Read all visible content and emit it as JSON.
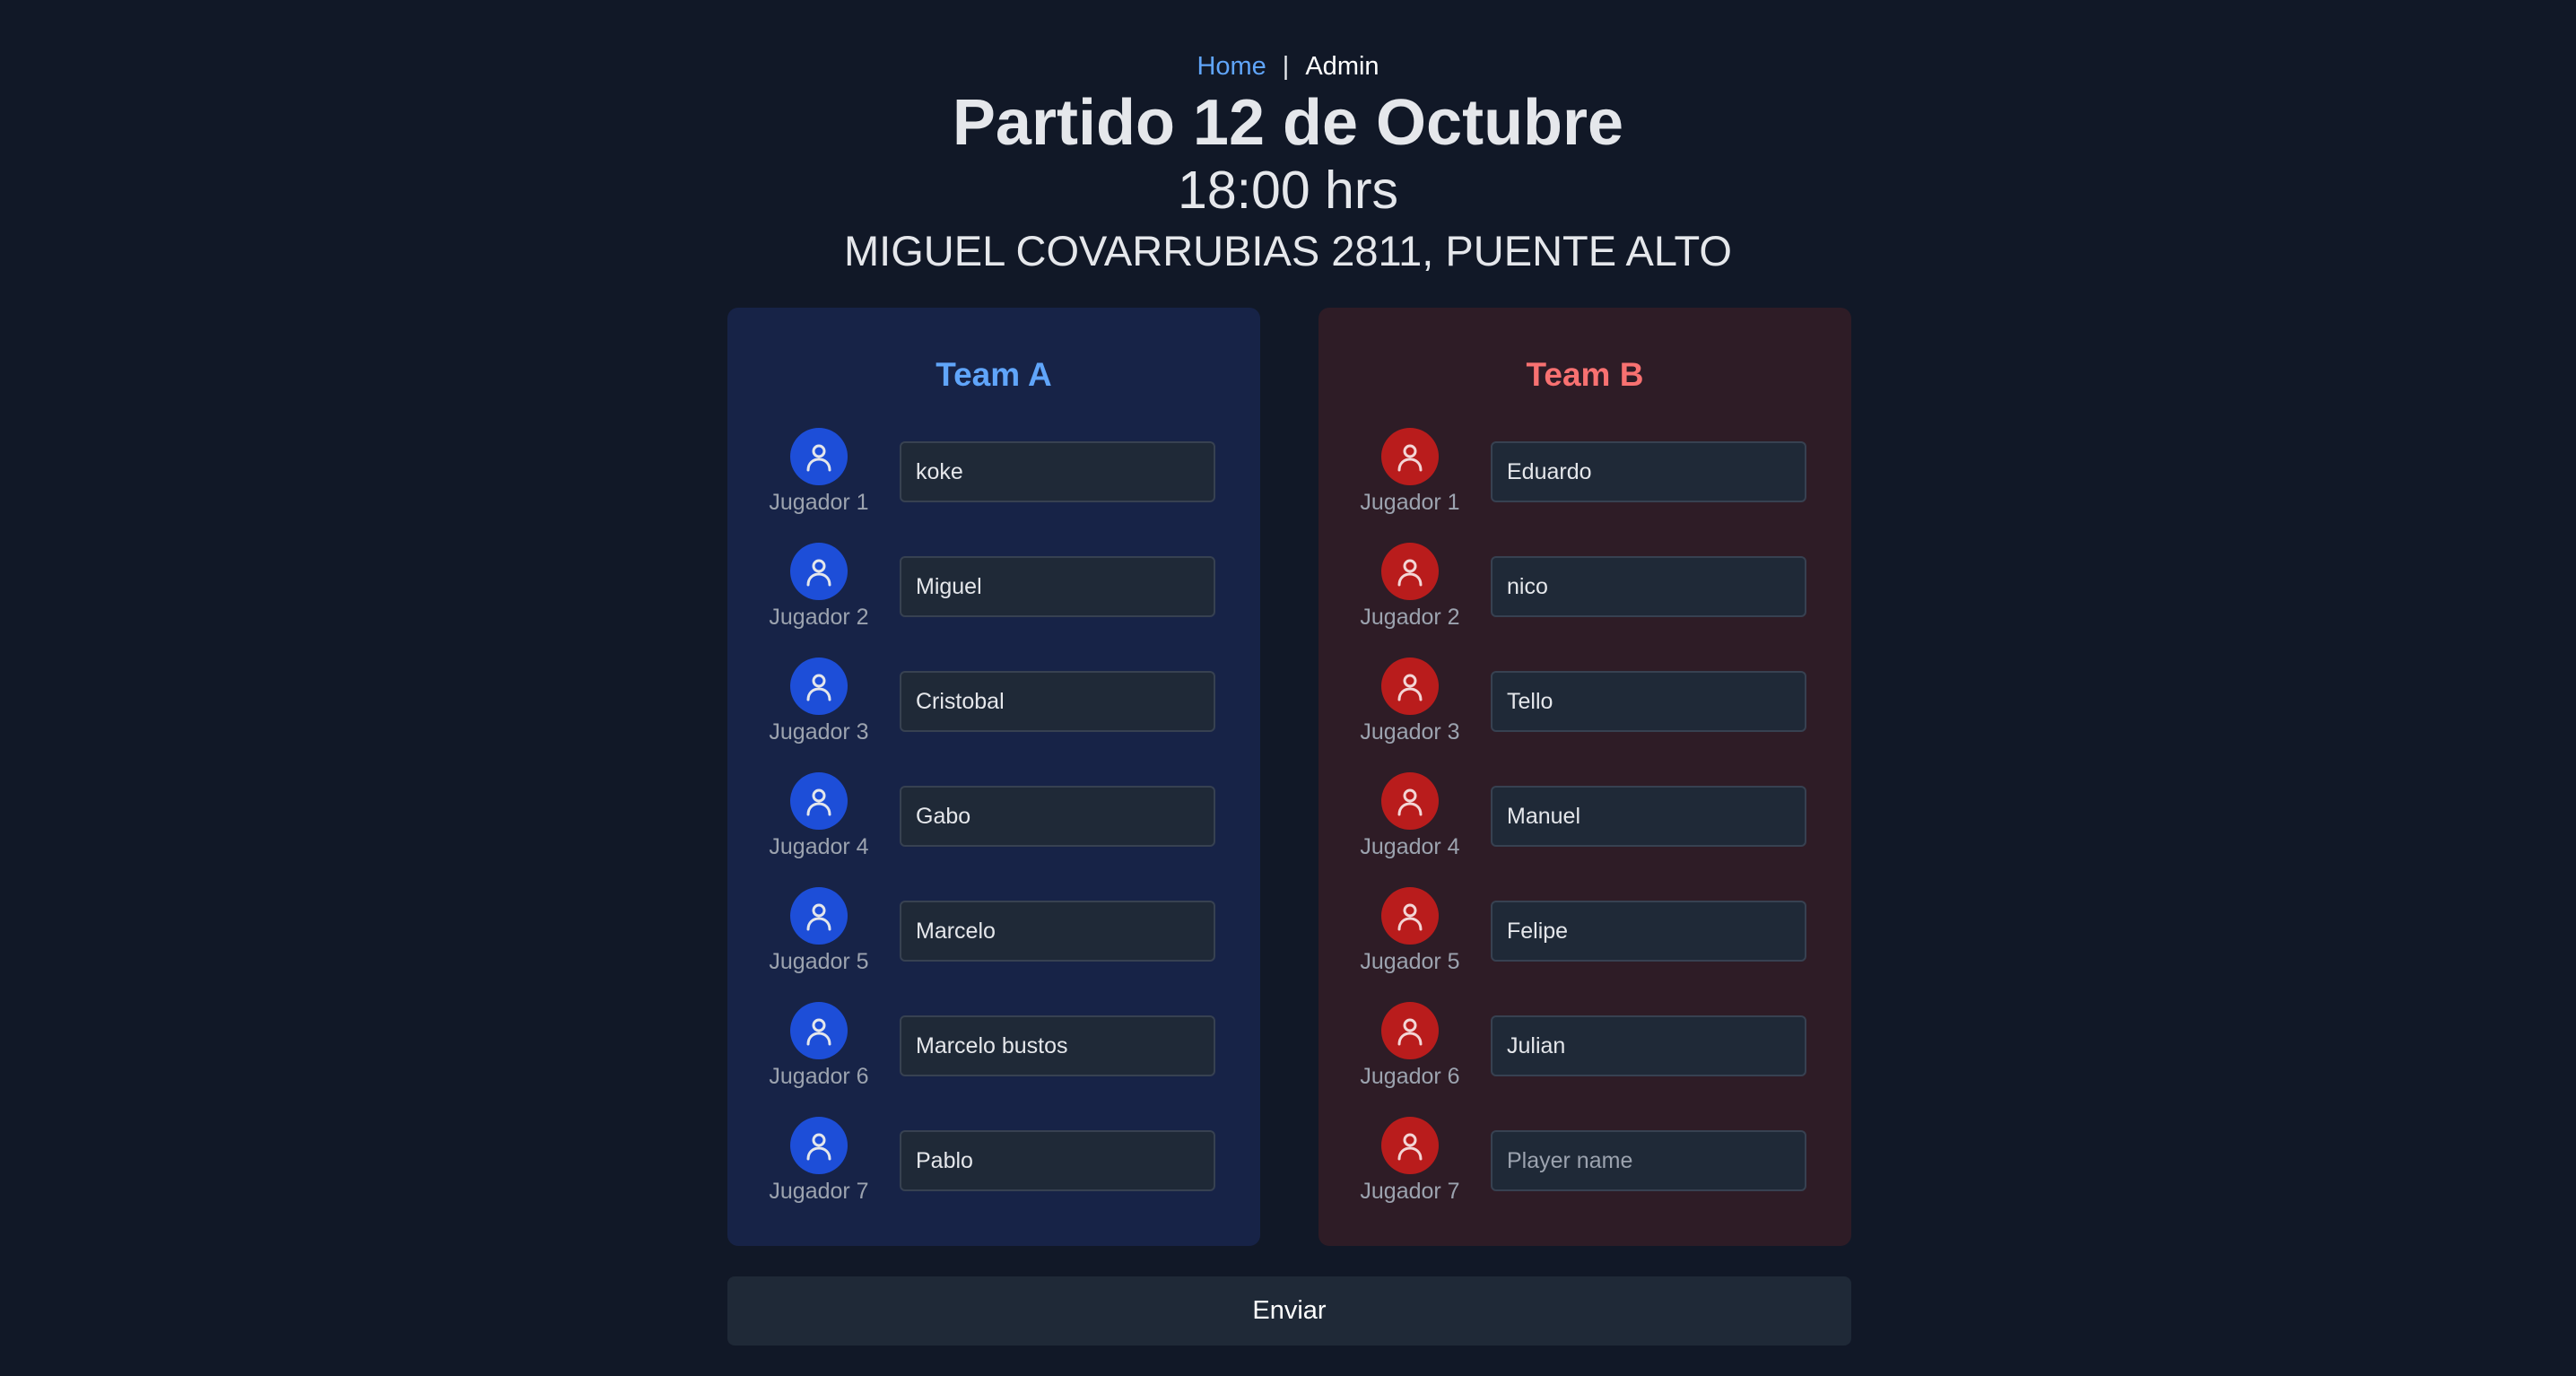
{
  "nav": {
    "home_label": "Home",
    "separator": "|",
    "admin_label": "Admin"
  },
  "match": {
    "title": "Partido 12 de Octubre",
    "time": "18:00 hrs",
    "address": "MIGUEL COVARRUBIAS 2811, PUENTE ALTO"
  },
  "icons": {
    "avatar": "user-icon"
  },
  "colors": {
    "background": "#111827",
    "team_a_accent": "#60a5fa",
    "team_b_accent": "#f87171",
    "team_a_avatar": "#1d4ed8",
    "team_b_avatar": "#b91c1c"
  },
  "team_a": {
    "title": "Team A",
    "players": [
      {
        "label": "Jugador 1",
        "value": "koke",
        "placeholder": "Player name"
      },
      {
        "label": "Jugador 2",
        "value": "Miguel",
        "placeholder": "Player name"
      },
      {
        "label": "Jugador 3",
        "value": "Cristobal",
        "placeholder": "Player name"
      },
      {
        "label": "Jugador 4",
        "value": "Gabo",
        "placeholder": "Player name"
      },
      {
        "label": "Jugador 5",
        "value": "Marcelo",
        "placeholder": "Player name"
      },
      {
        "label": "Jugador 6",
        "value": "Marcelo bustos",
        "placeholder": "Player name"
      },
      {
        "label": "Jugador 7",
        "value": "Pablo",
        "placeholder": "Player name"
      }
    ]
  },
  "team_b": {
    "title": "Team B",
    "players": [
      {
        "label": "Jugador 1",
        "value": "Eduardo",
        "placeholder": "Player name"
      },
      {
        "label": "Jugador 2",
        "value": "nico",
        "placeholder": "Player name"
      },
      {
        "label": "Jugador 3",
        "value": "Tello",
        "placeholder": "Player name"
      },
      {
        "label": "Jugador 4",
        "value": "Manuel",
        "placeholder": "Player name"
      },
      {
        "label": "Jugador 5",
        "value": "Felipe",
        "placeholder": "Player name"
      },
      {
        "label": "Jugador 6",
        "value": "Julian",
        "placeholder": "Player name"
      },
      {
        "label": "Jugador 7",
        "value": "",
        "placeholder": "Player name"
      }
    ]
  },
  "submit_label": "Enviar"
}
